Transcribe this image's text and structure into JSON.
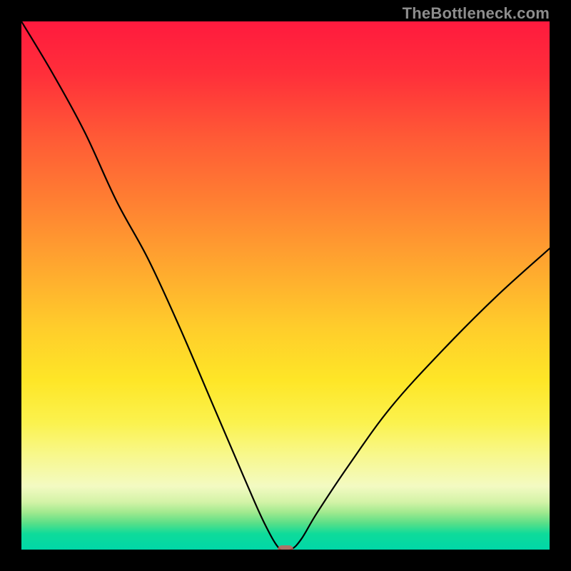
{
  "watermark": "TheBottleneck.com",
  "chart_data": {
    "type": "line",
    "title": "",
    "xlabel": "",
    "ylabel": "",
    "xlim": [
      0,
      100
    ],
    "ylim": [
      0,
      100
    ],
    "series": [
      {
        "name": "bottleneck-curve",
        "x": [
          0,
          6,
          12,
          18,
          24,
          30,
          36,
          42,
          46,
          49,
          51,
          53,
          56,
          62,
          70,
          80,
          90,
          100
        ],
        "values": [
          100,
          90,
          79,
          66,
          55,
          42,
          28,
          14,
          5,
          0,
          0,
          2,
          7,
          16,
          27,
          38,
          48,
          57
        ]
      }
    ],
    "marker": {
      "x": 50,
      "y": 0
    },
    "background": {
      "type": "vertical-gradient",
      "stops": [
        {
          "pos": 0,
          "color": "#ff1a3e"
        },
        {
          "pos": 50,
          "color": "#ffb42d"
        },
        {
          "pos": 80,
          "color": "#fbf24e"
        },
        {
          "pos": 100,
          "color": "#00d7a8"
        }
      ]
    }
  }
}
